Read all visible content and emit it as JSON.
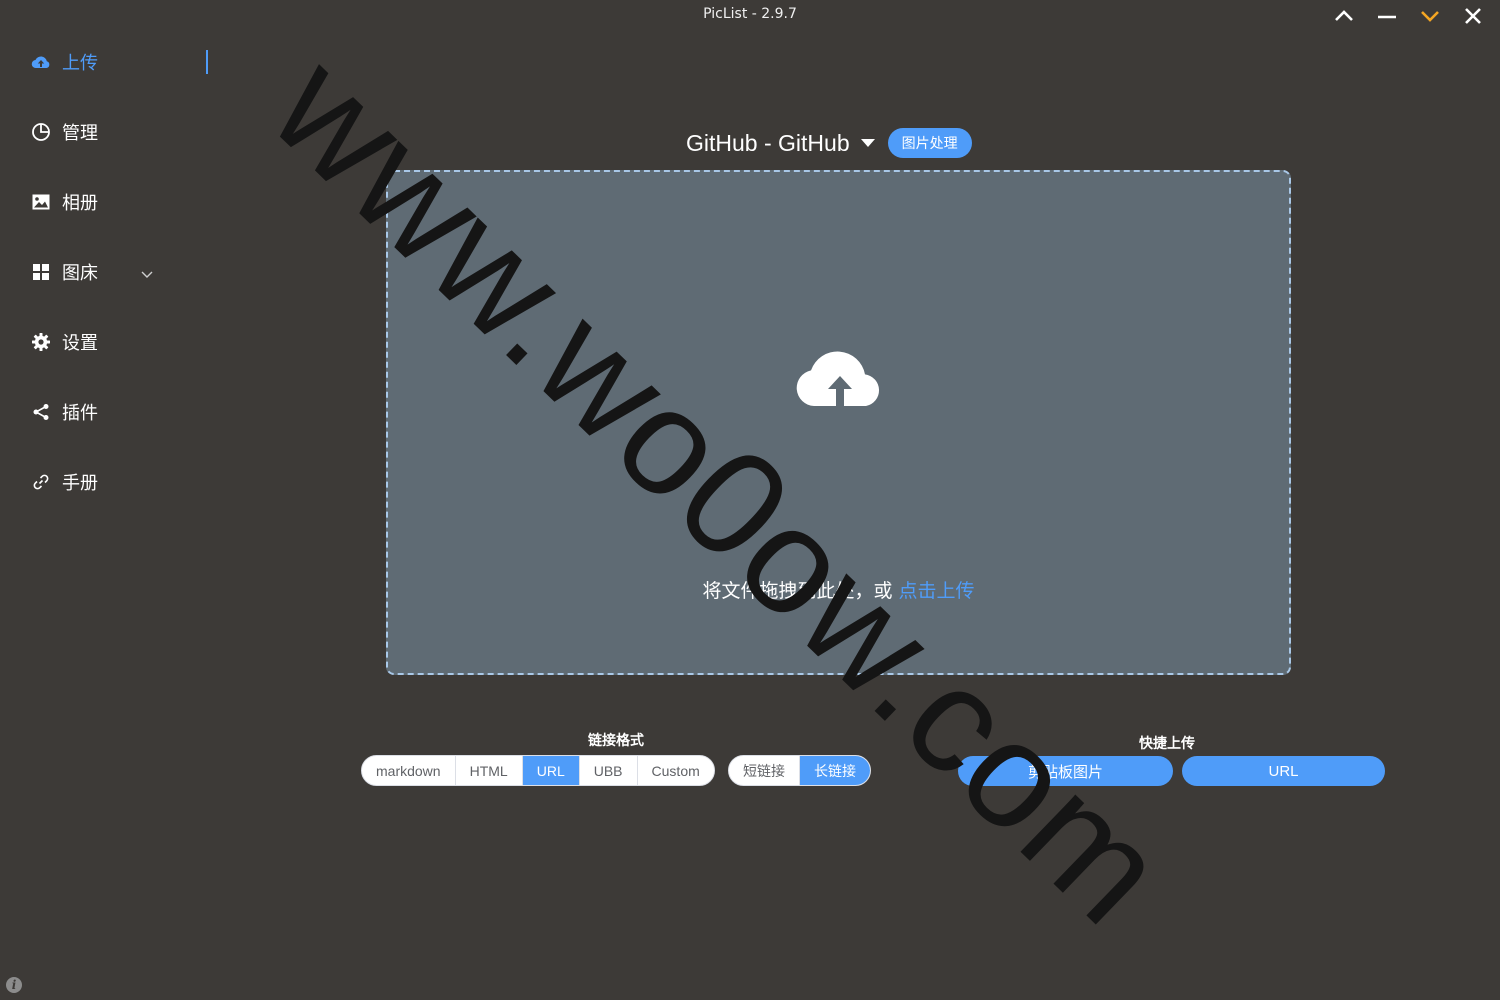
{
  "window": {
    "title": "PicList - 2.9.7",
    "controls": [
      "collapse-icon",
      "minimize-icon",
      "pin-icon",
      "close-icon"
    ],
    "pin_color": "#f5a623"
  },
  "sidebar": {
    "items": [
      {
        "label": "上传",
        "icon": "cloud-upload-icon",
        "active": true
      },
      {
        "label": "管理",
        "icon": "pie-chart-icon"
      },
      {
        "label": "相册",
        "icon": "image-icon"
      },
      {
        "label": "图床",
        "icon": "grid-icon",
        "expandable": true
      },
      {
        "label": "设置",
        "icon": "gear-icon"
      },
      {
        "label": "插件",
        "icon": "share-icon"
      },
      {
        "label": "手册",
        "icon": "link-icon"
      }
    ]
  },
  "upload": {
    "picbed": "GitHub - GitHub",
    "image_process_label": "图片处理",
    "drop_text": "将文件拖拽到此处，或 ",
    "drop_link": "点击上传"
  },
  "link_format": {
    "title": "链接格式",
    "options": [
      "markdown",
      "HTML",
      "URL",
      "UBB",
      "Custom"
    ],
    "selected": "URL",
    "length_options": [
      "短链接",
      "长链接"
    ],
    "length_selected": "长链接"
  },
  "quick_upload": {
    "title": "快捷上传",
    "clipboard_label": "剪贴板图片",
    "url_label": "URL"
  },
  "watermark": "www.wo0ow.com",
  "colors": {
    "accent": "#4f9cf9",
    "background": "#3d3a37",
    "dropzone": "#5f6b74"
  }
}
